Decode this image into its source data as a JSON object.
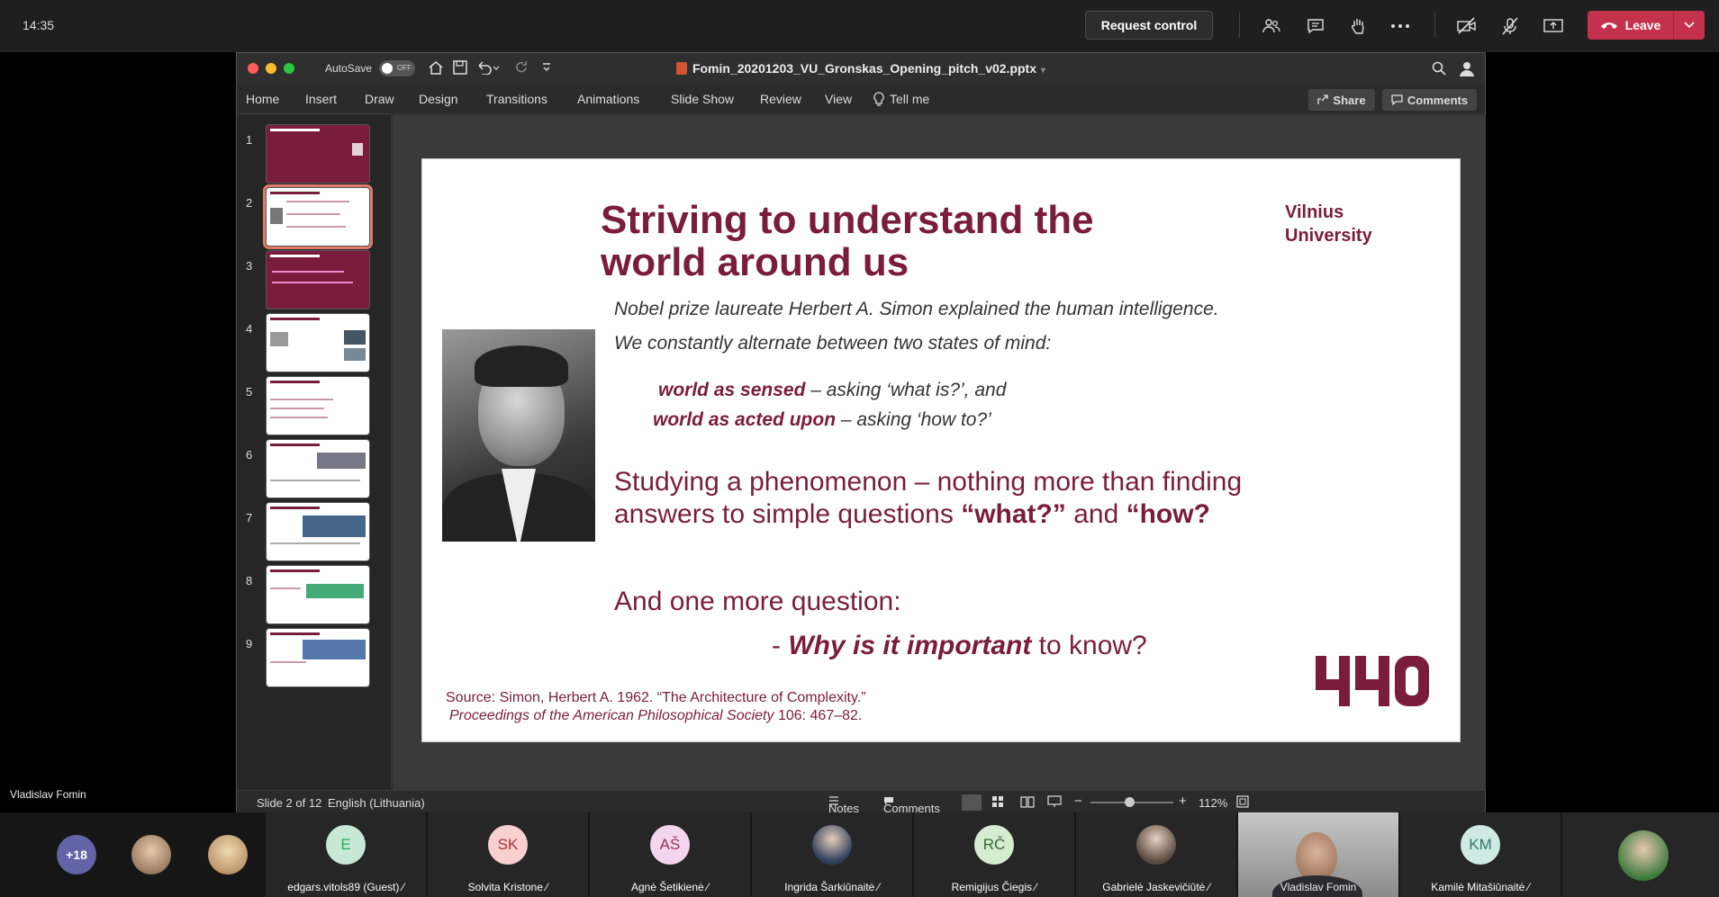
{
  "topbar": {
    "clock": "14:35",
    "request_control": "Request control",
    "leave": "Leave"
  },
  "window": {
    "autosave": "AutoSave",
    "toggle": "OFF",
    "file_title": "Fomin_20201203_VU_Gronskas_Opening_pitch_v02.pptx"
  },
  "ribbon": {
    "tabs": [
      "Home",
      "Insert",
      "Draw",
      "Design",
      "Transitions",
      "Animations",
      "Slide Show",
      "Review",
      "View",
      "Tell me"
    ],
    "share": "Share",
    "comments": "Comments"
  },
  "thumbnails": {
    "numbers": [
      "1",
      "2",
      "3",
      "4",
      "5",
      "6",
      "7",
      "8",
      "9"
    ],
    "selected": 2
  },
  "slide": {
    "title": "Striving to understand the world around us",
    "university": "Vilnius University",
    "intro1": "Nobel prize laureate Herbert A. Simon explained the human intelligence.",
    "intro2": "We constantly alternate between two states of mind:",
    "sensed_bold": "world as sensed",
    "sensed_rest": " – asking ‘what is?’, and",
    "acted_bold": "world as acted upon",
    "acted_rest": " – asking ‘how to?’",
    "big1": "Studying a phenomenon – nothing more than finding",
    "big2_pre": "answers to simple questions ",
    "big2_what": "“what?”",
    "big2_and": " and ",
    "big2_how": "“how?",
    "q1": "And one more question:",
    "q2_pre": "- ",
    "q2_bold": "Why is it important",
    "q2_rest": " to know?",
    "source1": "Source: Simon, Herbert A. 1962. “The Architecture of Complexity.”",
    "source2_italic": "Proceedings of the American Philosophical Society",
    "source2_rest": " 106: 467–82."
  },
  "status": {
    "slide": "Slide 2 of 12",
    "language": "English (Lithuania)",
    "notes": "Notes",
    "comments": "Comments",
    "zoom": "112%"
  },
  "presenter_name": "Vladislav Fomin",
  "participants": {
    "more": "+18",
    "named": [
      {
        "initials": "E",
        "name": "edgars.vitols89 (Guest)"
      },
      {
        "initials": "SK",
        "name": "Solvita Kristone"
      },
      {
        "initials": "AŠ",
        "name": "Agnė Šetikienė"
      },
      {
        "initials": "",
        "name": "Ingrida Šarkiūnaitė"
      },
      {
        "initials": "RČ",
        "name": "Remigijus Čiegis"
      },
      {
        "initials": "",
        "name": "Gabrielė Jaskevičiūtė"
      },
      {
        "initials": "",
        "name": "Vladislav Fomin"
      },
      {
        "initials": "KM",
        "name": "Kamilė Mitašiūnaitė"
      }
    ]
  },
  "colors": {
    "accent": "#7a1d3c",
    "leave": "#c4314b"
  }
}
